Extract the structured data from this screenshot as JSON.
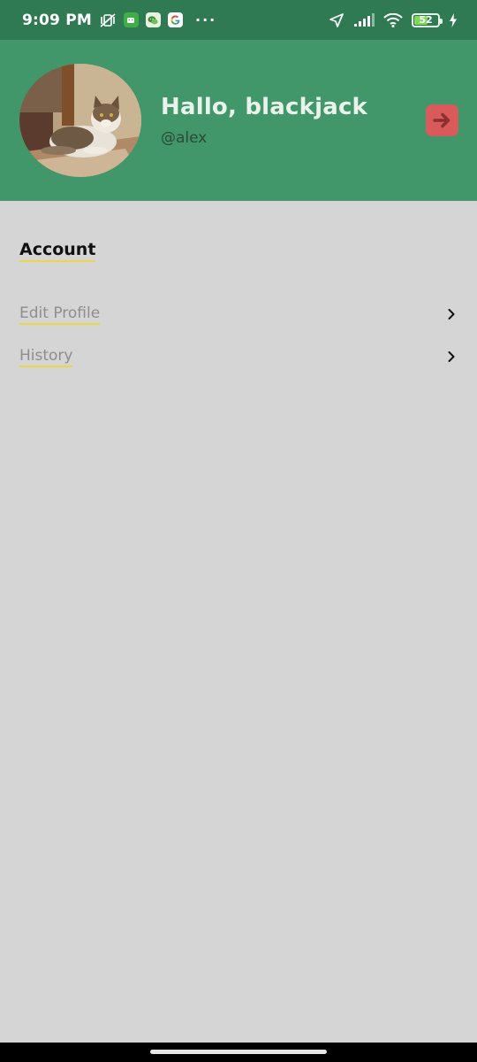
{
  "status_bar": {
    "time": "9:09 PM",
    "battery_level": "52",
    "icons": [
      "muted-vibrate-icon",
      "android-app-icon",
      "wechat-app-icon",
      "google-app-icon",
      "more-dots-icon",
      "location-arrow-icon",
      "signal-icon",
      "wifi-icon",
      "battery-icon",
      "charging-icon"
    ],
    "dots": "···"
  },
  "header": {
    "greeting": "Hallo, blackjack",
    "username": "@alex",
    "avatar": "cat-photo",
    "logout_icon": "logout-arrow-icon"
  },
  "account": {
    "title": "Account",
    "items": [
      {
        "label": "Edit Profile",
        "icon": "chevron-right-icon"
      },
      {
        "label": "History",
        "icon": "chevron-right-icon"
      }
    ]
  },
  "colors": {
    "status_bar": "#2f7a52",
    "header": "#41966a",
    "background": "#d5d5d5",
    "logout": "#d95a5a",
    "underline": "#e6d84a"
  }
}
